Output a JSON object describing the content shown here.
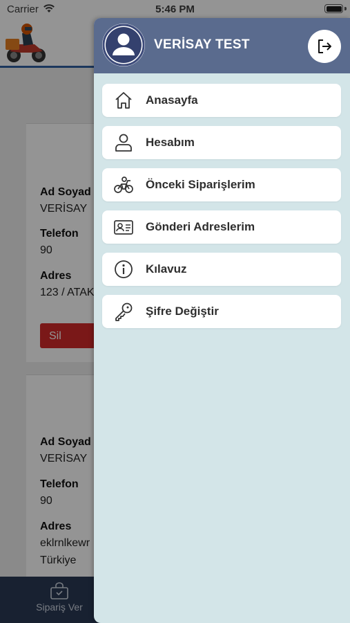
{
  "status_bar": {
    "carrier": "Carrier",
    "time": "5:46 PM"
  },
  "background": {
    "orders": [
      {
        "name_label": "Ad Soyad",
        "name_value": "VERİSAY",
        "phone_label": "Telefon",
        "phone_value": "90",
        "address_label": "Adres",
        "address_value": "123 / ATAK",
        "delete_label": "Sil"
      },
      {
        "name_label": "Ad Soyad",
        "name_value": "VERİSAY",
        "phone_label": "Telefon",
        "phone_value": "90",
        "address_label": "Adres",
        "address_value": "eklrnlkewr",
        "address_value_2": "Türkiye"
      }
    ],
    "tabbar": {
      "order_label": "Sipariş Ver"
    }
  },
  "drawer": {
    "user_name": "VERİSAY TEST",
    "menu": [
      {
        "label": "Anasayfa",
        "icon": "home-icon"
      },
      {
        "label": "Hesabım",
        "icon": "user-icon"
      },
      {
        "label": "Önceki Siparişlerim",
        "icon": "motorcycle-icon"
      },
      {
        "label": "Gönderi Adreslerim",
        "icon": "id-card-icon"
      },
      {
        "label": "Kılavuz",
        "icon": "info-icon"
      },
      {
        "label": "Şifre Değiştir",
        "icon": "key-icon"
      }
    ]
  },
  "colors": {
    "header": "#5a6b8e",
    "drawer_bg": "#d3e5e8",
    "tabbar": "#2a3a55",
    "delete": "#d22a2a"
  }
}
